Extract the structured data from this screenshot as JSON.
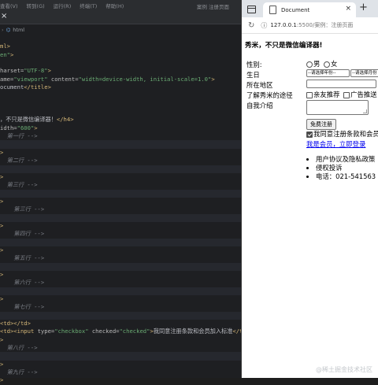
{
  "editor": {
    "menu": [
      "查看(V)",
      "转到(G)",
      "运行(R)",
      "终端(T)",
      "帮助(H)"
    ],
    "menu_right": "案例  注册页面",
    "breadcrumb": "html",
    "code_lines": [
      {
        "cls": "",
        "parts": [
          [
            "txt",
            ""
          ]
        ]
      },
      {
        "cls": "",
        "parts": [
          [
            "tag",
            "ml>"
          ]
        ]
      },
      {
        "cls": "",
        "parts": [
          [
            "val",
            "en\""
          ],
          [
            "tag",
            ">"
          ]
        ]
      },
      {
        "cls": "",
        "parts": [
          [
            "txt",
            ""
          ]
        ]
      },
      {
        "cls": "",
        "parts": [
          [
            "attr",
            "harset="
          ],
          [
            "val",
            "\"UTF-8\""
          ],
          [
            "tag",
            ">"
          ]
        ]
      },
      {
        "cls": "",
        "parts": [
          [
            "attr",
            "ame="
          ],
          [
            "val",
            "\"viewport\""
          ],
          [
            "attr",
            " content="
          ],
          [
            "val",
            "\"width=device-width, initial-scale=1.0\""
          ],
          [
            "tag",
            ">"
          ]
        ]
      },
      {
        "cls": "",
        "parts": [
          [
            "txt",
            "ocument"
          ],
          [
            "tag",
            "</title>"
          ]
        ]
      },
      {
        "cls": "",
        "parts": [
          [
            "txt",
            ""
          ]
        ]
      },
      {
        "cls": "",
        "parts": [
          [
            "txt",
            ""
          ]
        ]
      },
      {
        "cls": "",
        "parts": [
          [
            "txt",
            ""
          ]
        ]
      },
      {
        "cls": "",
        "parts": [
          [
            "txt",
            "，不只是微信编译器！"
          ],
          [
            "tag",
            "</h4>"
          ]
        ]
      },
      {
        "cls": "",
        "parts": [
          [
            "attr",
            "idth="
          ],
          [
            "val",
            "\"600\""
          ],
          [
            "tag",
            ">"
          ]
        ]
      },
      {
        "cls": "",
        "parts": [
          [
            "cmt",
            "  第一行 -->"
          ]
        ]
      },
      {
        "cls": "hl",
        "parts": [
          [
            "txt",
            ""
          ]
        ]
      },
      {
        "cls": "",
        "parts": [
          [
            "tag",
            ">"
          ]
        ]
      },
      {
        "cls": "",
        "parts": [
          [
            "cmt",
            "  第二行 -->"
          ]
        ]
      },
      {
        "cls": "hl",
        "parts": [
          [
            "txt",
            ""
          ]
        ]
      },
      {
        "cls": "",
        "parts": [
          [
            "tag",
            ">"
          ]
        ]
      },
      {
        "cls": "",
        "parts": [
          [
            "cmt",
            "  第三行 -->"
          ]
        ]
      },
      {
        "cls": "hl",
        "parts": [
          [
            "txt",
            ""
          ]
        ]
      },
      {
        "cls": "",
        "parts": [
          [
            "tag",
            ">"
          ]
        ]
      },
      {
        "cls": "",
        "parts": [
          [
            "cmt",
            "    第三行 -->"
          ]
        ]
      },
      {
        "cls": "hl",
        "parts": [
          [
            "txt",
            ""
          ]
        ]
      },
      {
        "cls": "",
        "parts": [
          [
            "tag",
            ">"
          ]
        ]
      },
      {
        "cls": "",
        "parts": [
          [
            "cmt",
            "    第四行 -->"
          ]
        ]
      },
      {
        "cls": "hl",
        "parts": [
          [
            "txt",
            ""
          ]
        ]
      },
      {
        "cls": "",
        "parts": [
          [
            "tag",
            ">"
          ]
        ]
      },
      {
        "cls": "",
        "parts": [
          [
            "cmt",
            "    第五行 -->"
          ]
        ]
      },
      {
        "cls": "hl",
        "parts": [
          [
            "txt",
            ""
          ]
        ]
      },
      {
        "cls": "",
        "parts": [
          [
            "tag",
            ">"
          ]
        ]
      },
      {
        "cls": "",
        "parts": [
          [
            "cmt",
            "    第六行 -->"
          ]
        ]
      },
      {
        "cls": "hl",
        "parts": [
          [
            "txt",
            ""
          ]
        ]
      },
      {
        "cls": "",
        "parts": [
          [
            "tag",
            ">"
          ]
        ]
      },
      {
        "cls": "",
        "parts": [
          [
            "cmt",
            "    第七行 -->"
          ]
        ]
      },
      {
        "cls": "hl",
        "parts": [
          [
            "txt",
            ""
          ]
        ]
      },
      {
        "cls": "",
        "parts": [
          [
            "tag",
            "<td></td>"
          ]
        ]
      },
      {
        "cls": "",
        "parts": [
          [
            "tag",
            "<td><input "
          ],
          [
            "attr",
            "type="
          ],
          [
            "val",
            "\"checkbox\""
          ],
          [
            "attr",
            " checked="
          ],
          [
            "val",
            "\"checked\""
          ],
          [
            "tag",
            ">"
          ],
          [
            "txt",
            "我同意注册条款和会员加入标准"
          ],
          [
            "tag",
            "</td>"
          ]
        ]
      },
      {
        "cls": "",
        "parts": [
          [
            "tag",
            ">"
          ]
        ]
      },
      {
        "cls": "",
        "parts": [
          [
            "cmt",
            "  第八行 -->"
          ]
        ]
      },
      {
        "cls": "hl",
        "parts": [
          [
            "txt",
            ""
          ]
        ]
      },
      {
        "cls": "",
        "parts": [
          [
            "tag",
            ">"
          ]
        ]
      },
      {
        "cls": "",
        "parts": [
          [
            "cmt",
            "  第九行 -->"
          ]
        ]
      },
      {
        "cls": "",
        "parts": [
          [
            "tag",
            ">"
          ]
        ]
      }
    ]
  },
  "browser": {
    "tab_title": "Document",
    "url_host": "127.0.0.1",
    "url_rest": ":5500/案例：注册页面",
    "heading": "秀米，不只是微信编译器!",
    "rows": {
      "gender_label": "性别:",
      "male": "男",
      "female": "女",
      "birthday_label": "生日",
      "year_select": "--请选择年份--",
      "month_select": "--请选择月份",
      "region_label": "所在地区",
      "source_label": "了解秀米的途径",
      "source_opt1": "亲友推荐",
      "source_opt2": "广告推送",
      "intro_label": "自我介绍",
      "register_btn": "免费注册",
      "agree_text": "我同意注册条款和会员",
      "login_link": "我是会员，立即登录"
    },
    "list": [
      "用户协议及隐私政策",
      "侵权投诉",
      "电话：021-541563"
    ]
  },
  "watermark": "@稀土掘金技术社区"
}
